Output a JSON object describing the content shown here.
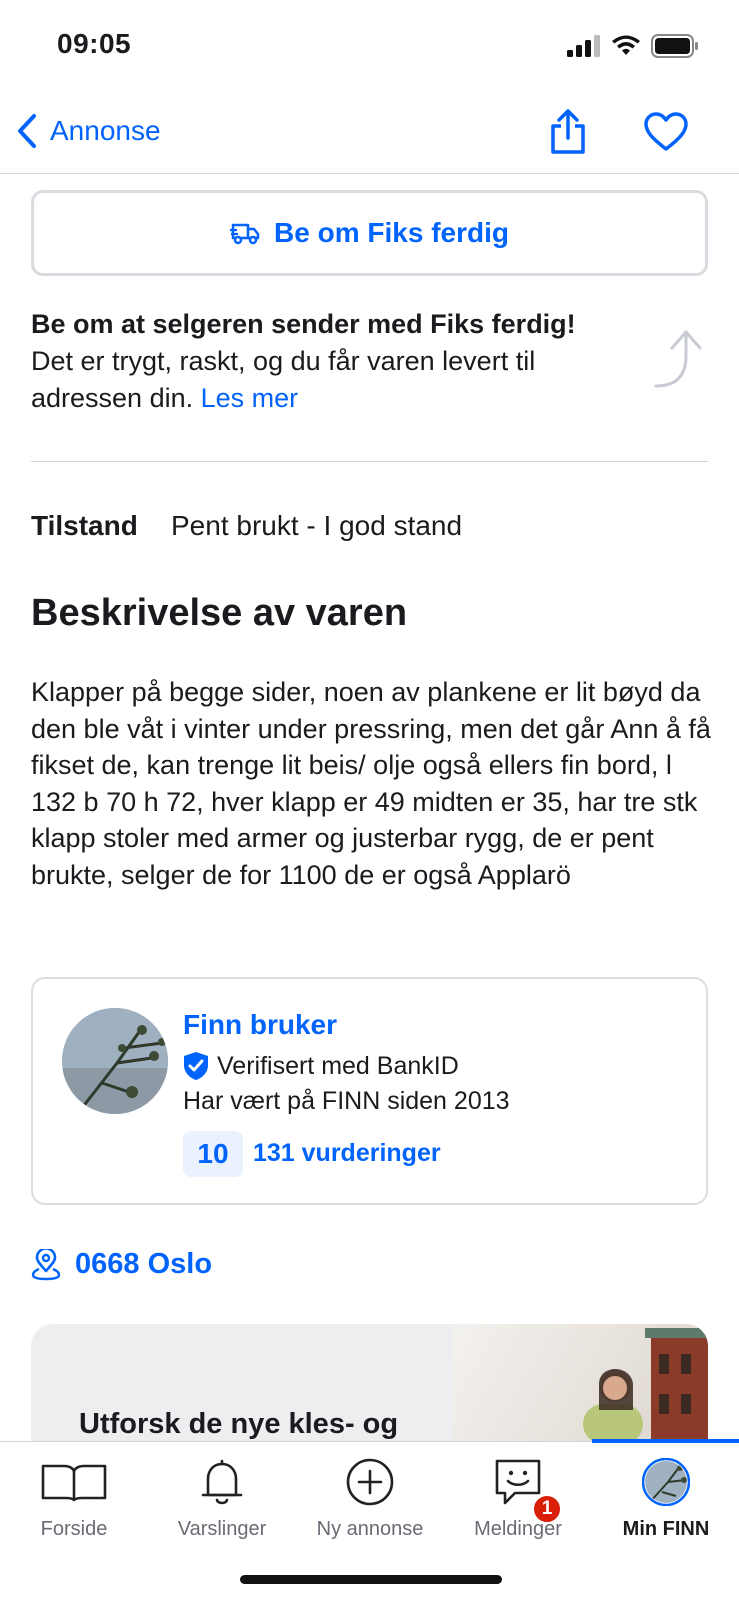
{
  "status_bar": {
    "time": "09:05"
  },
  "nav": {
    "back_label": "Annonse"
  },
  "fiks": {
    "button_label": "Be om Fiks ferdig",
    "promo_title": "Be om at selgeren sender med Fiks ferdig!",
    "promo_text": "Det er trygt, raskt, og du får varen levert til adressen din.",
    "promo_link": "Les mer"
  },
  "condition": {
    "label": "Tilstand",
    "value": "Pent brukt - I god stand"
  },
  "description": {
    "title": "Beskrivelse av varen",
    "body": "Klapper på begge sider, noen av plankene er lit bøyd da den ble våt i vinter under pressring, men det går Ann å få fikset de, kan trenge lit beis/ olje også ellers fin bord, l 132 b 70 h 72, hver klapp er 49 midten er 35, har tre stk klapp stoler med armer og justerbar rygg, de er pent brukte, selger de for 1100 de er også Applarö"
  },
  "seller": {
    "name": "Finn bruker",
    "verified": "Verifisert med BankID",
    "since": "Har vært på FINN siden 2013",
    "score": "10",
    "reviews": "131 vurderinger"
  },
  "location": {
    "text": "0668 Oslo"
  },
  "banner": {
    "text": "Utforsk de nye kles- og"
  },
  "tabs": [
    {
      "label": "Forside",
      "icon": "book-icon"
    },
    {
      "label": "Varslinger",
      "icon": "bell-icon"
    },
    {
      "label": "Ny annonse",
      "icon": "plus-circle-icon"
    },
    {
      "label": "Meldinger",
      "icon": "chat-icon",
      "badge": "1"
    },
    {
      "label": "Min FINN",
      "icon": "avatar-icon",
      "active": true
    }
  ],
  "colors": {
    "accent": "#0063fb",
    "badge": "#d91f0a",
    "text": "#1b1b1f"
  }
}
